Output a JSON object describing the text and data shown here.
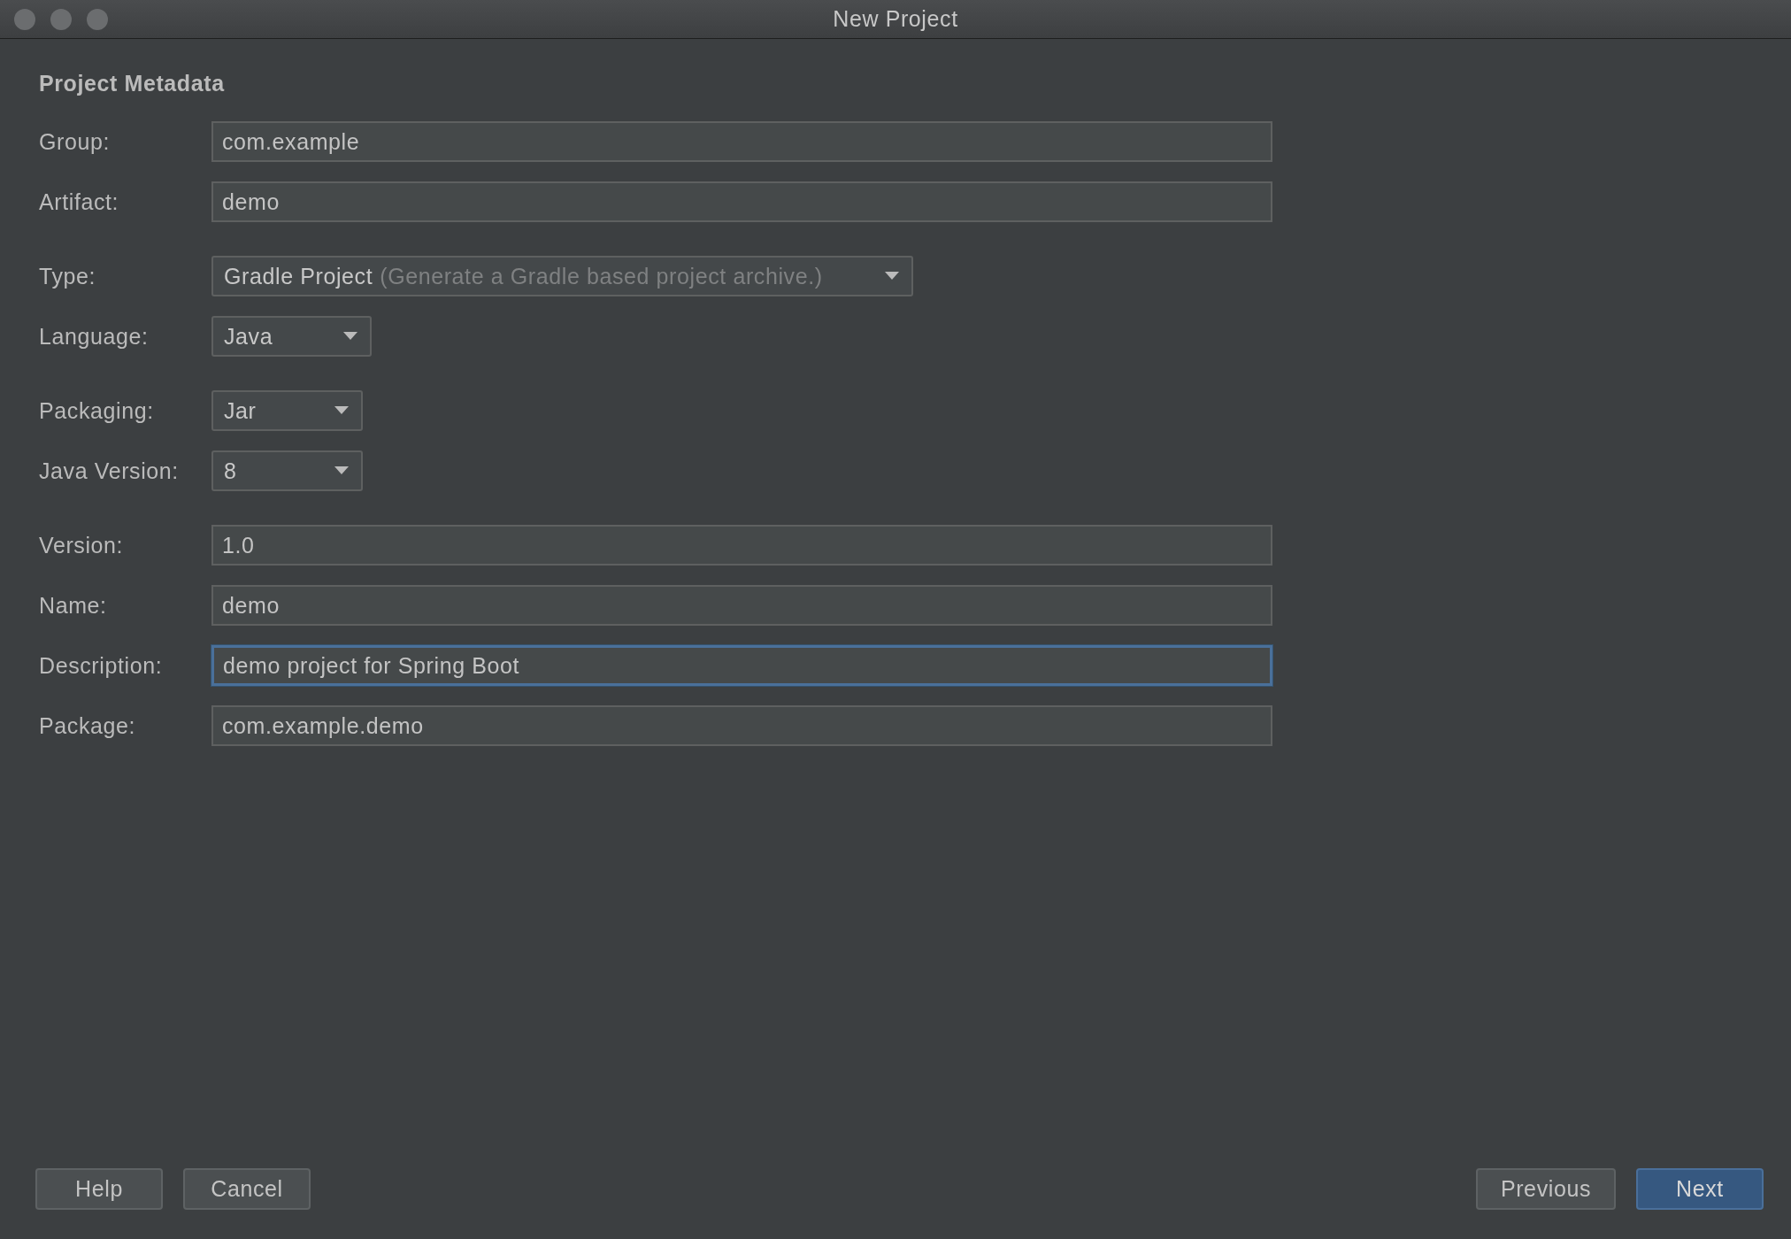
{
  "window": {
    "title": "New Project"
  },
  "heading": "Project Metadata",
  "sections": [
    [
      {
        "kind": "text",
        "label": "Group:",
        "value": "com.example",
        "focused": false
      },
      {
        "kind": "text",
        "label": "Artifact:",
        "value": "demo",
        "focused": false
      }
    ],
    [
      {
        "kind": "dropdown",
        "label": "Type:",
        "value": "Gradle Project",
        "hint": "(Generate a Gradle based project archive.)"
      },
      {
        "kind": "dropdown",
        "label": "Language:",
        "value": "Java"
      }
    ],
    [
      {
        "kind": "dropdown",
        "label": "Packaging:",
        "value": "Jar"
      },
      {
        "kind": "dropdown",
        "label": "Java Version:",
        "value": "8"
      }
    ],
    [
      {
        "kind": "text",
        "label": "Version:",
        "value": "1.0",
        "focused": false
      },
      {
        "kind": "text",
        "label": "Name:",
        "value": "demo",
        "focused": false
      },
      {
        "kind": "text",
        "label": "Description:",
        "value": "demo project for Spring Boot",
        "focused": true
      },
      {
        "kind": "text",
        "label": "Package:",
        "value": "com.example.demo",
        "focused": false
      }
    ]
  ],
  "buttons_left": [
    {
      "label": "Help",
      "default": false
    },
    {
      "label": "Cancel",
      "default": false
    }
  ],
  "buttons_right": [
    {
      "label": "Previous",
      "default": false
    },
    {
      "label": "Next",
      "default": true
    }
  ]
}
